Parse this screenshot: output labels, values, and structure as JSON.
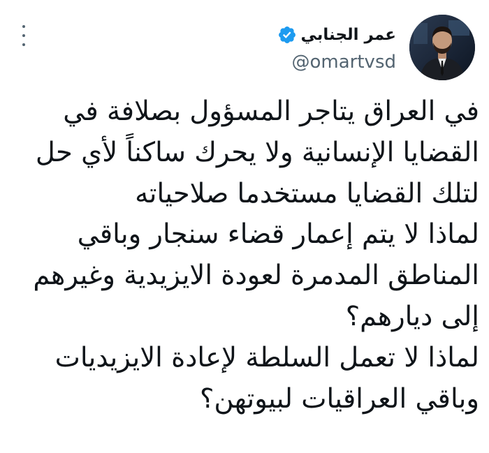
{
  "author": {
    "display_name": "عمر الجنابي",
    "handle": "@omartvsd",
    "verified": true
  },
  "icons": {
    "verified": "verified-badge-icon",
    "more": "more-options-icon"
  },
  "colors": {
    "text": "#0f1419",
    "secondary_text": "#536471",
    "verified_blue": "#1d9bf0",
    "background": "#ffffff"
  },
  "tweet": {
    "lines": [
      "في العراق يتاجر المسؤول بصلافة في",
      "القضايا الإنسانية ولا يحرك ساكناً لأي حل",
      "لتلك القضايا مستخدما صلاحياته",
      "لماذا لا يتم إعمار قضاء سنجار وباقي",
      "المناطق المدمرة لعودة الايزيدية وغيرهم",
      "إلى ديارهم؟",
      "لماذا لا تعمل السلطة لإعادة الايزيديات",
      "وباقي العراقيات لبيوتهن؟"
    ]
  }
}
